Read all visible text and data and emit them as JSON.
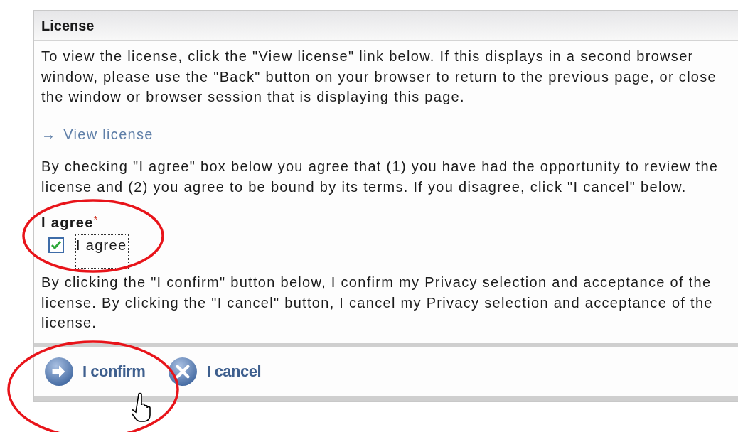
{
  "panel": {
    "title": "License",
    "intro": "To view the license, click the \"View license\" link below. If this displays in a second browser window, please use the \"Back\" button on your browser to return to the previous page, or close the window or browser session that is displaying this page.",
    "link": {
      "arrow": "→",
      "label": "View license"
    },
    "agreement_text": "By checking \"I agree\" box below you agree that (1) you have had the opportunity to review the license and (2) you agree to be bound by its terms. If you disagree, click \"I cancel\" below.",
    "field": {
      "label": "I agree",
      "required_mark": "*",
      "option": {
        "label": "I agree",
        "checked": true,
        "focused": true
      }
    },
    "confirmation_text": "By clicking the \"I confirm\" button below, I confirm my Privacy selection and acceptance of the license. By clicking the \"I cancel\" button, I cancel my Privacy selection and acceptance of the license.",
    "buttons": [
      {
        "kind": "confirm",
        "label": "I confirm"
      },
      {
        "kind": "cancel",
        "label": "I cancel"
      }
    ]
  }
}
